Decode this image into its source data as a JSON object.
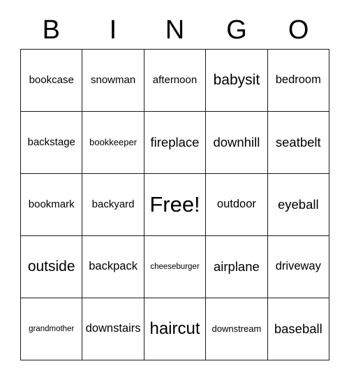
{
  "card": {
    "title": "BINGO",
    "header_letters": [
      "B",
      "I",
      "N",
      "G",
      "O"
    ],
    "background_color": "#ffffff",
    "border_color": "#1a1a1a",
    "text_color": "#000000",
    "grid_size": "5x5"
  },
  "grid": {
    "rows": [
      [
        {
          "text": "bookcase",
          "size": "fs-m"
        },
        {
          "text": "snowman",
          "size": "fs-m"
        },
        {
          "text": "afternoon",
          "size": "fs-m"
        },
        {
          "text": "babysit",
          "size": "fs-xl"
        },
        {
          "text": "bedroom",
          "size": "fs-ml"
        }
      ],
      [
        {
          "text": "backstage",
          "size": "fs-m"
        },
        {
          "text": "bookkeeper",
          "size": "fs-s"
        },
        {
          "text": "fireplace",
          "size": "fs-l"
        },
        {
          "text": "downhill",
          "size": "fs-l"
        },
        {
          "text": "seatbelt",
          "size": "fs-l"
        }
      ],
      [
        {
          "text": "bookmark",
          "size": "fs-m"
        },
        {
          "text": "backyard",
          "size": "fs-m"
        },
        {
          "text": "Free!",
          "size": "fs-free"
        },
        {
          "text": "outdoor",
          "size": "fs-ml"
        },
        {
          "text": "eyeball",
          "size": "fs-l"
        }
      ],
      [
        {
          "text": "outside",
          "size": "fs-xl"
        },
        {
          "text": "backpack",
          "size": "fs-ml"
        },
        {
          "text": "cheeseburger",
          "size": "fs-xs"
        },
        {
          "text": "airplane",
          "size": "fs-l"
        },
        {
          "text": "driveway",
          "size": "fs-ml"
        }
      ],
      [
        {
          "text": "grandmother",
          "size": "fs-xs"
        },
        {
          "text": "downstairs",
          "size": "fs-ml"
        },
        {
          "text": "haircut",
          "size": "fs-xxl"
        },
        {
          "text": "downstream",
          "size": "fs-s"
        },
        {
          "text": "baseball",
          "size": "fs-l"
        }
      ]
    ]
  }
}
